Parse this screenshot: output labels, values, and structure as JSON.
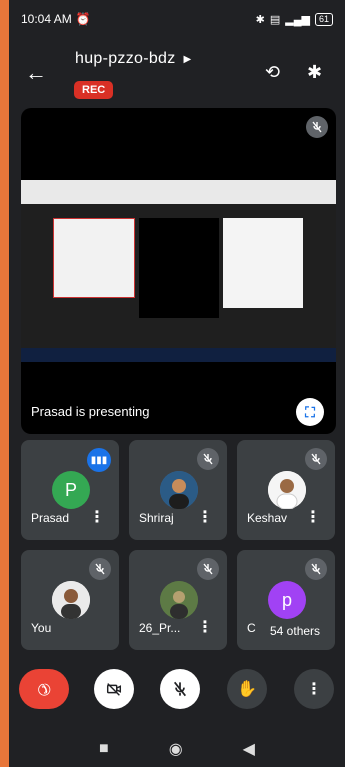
{
  "status": {
    "time": "10:04 AM",
    "alarm_icon": "alarm-icon",
    "battery": "61"
  },
  "meeting": {
    "code": "hup-pzzo-bdz",
    "rec": "REC"
  },
  "presenter": {
    "label": "Prasad is presenting"
  },
  "participants": [
    {
      "name": "Prasad",
      "initial": "P",
      "avatar_color": "#34a853"
    },
    {
      "name": "Shriraj"
    },
    {
      "name": "Keshav"
    },
    {
      "name": "You"
    },
    {
      "name": "26_Pr..."
    },
    {
      "name": "C",
      "initial": "p",
      "avatar_color": "#a142f4"
    }
  ],
  "others": "54 others",
  "colors": {
    "end_call": "#ea4335",
    "rec": "#d93025",
    "tile": "#3c4043",
    "accent": "#1a73e8"
  }
}
